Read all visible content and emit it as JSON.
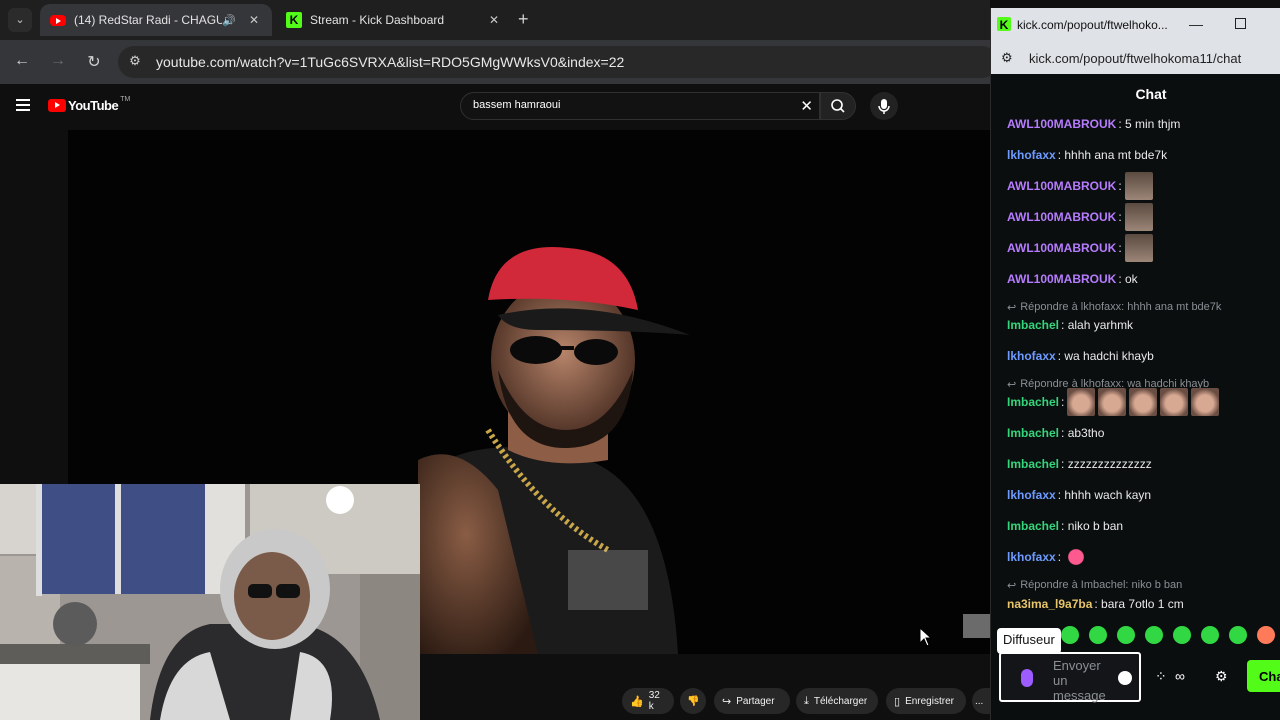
{
  "browser": {
    "tabs": [
      {
        "title": "(14) RedStar Radi - CHAGU",
        "favicon": "youtube-icon",
        "active": true
      },
      {
        "title": "Stream - Kick Dashboard",
        "favicon": "kick-icon",
        "active": false
      }
    ],
    "new_tab_label": "+",
    "url": "youtube.com/watch?v=1TuGc6SVRXA&list=RDO5GMgWWksV0&index=22"
  },
  "youtube": {
    "logo": "YouTube",
    "logo_tm": "TM",
    "search_query": "bassem hamraoui",
    "actions": {
      "likes": "32 k",
      "share": "Partager",
      "download": "Télécharger",
      "save": "Enregistrer",
      "more": "..."
    }
  },
  "kick": {
    "window_title": "kick.com/popout/ftwelhoko...",
    "url": "kick.com/popout/ftwelhokoma11/chat",
    "header": "Chat",
    "messages": [
      {
        "kind": "msg",
        "user": "AWL100MABROUK",
        "text": ": 5 min thjm",
        "color": "#b67cff"
      },
      {
        "kind": "msg",
        "user": "lkhofaxx",
        "text": ": hhhh ana mt bde7k",
        "color": "#6e9bff"
      },
      {
        "kind": "msg",
        "user": "AWL100MABROUK",
        "text": ":",
        "color": "#b67cff",
        "emotes": 1
      },
      {
        "kind": "msg",
        "user": "AWL100MABROUK",
        "text": ":",
        "color": "#b67cff",
        "emotes": 1
      },
      {
        "kind": "msg",
        "user": "AWL100MABROUK",
        "text": ":",
        "color": "#b67cff",
        "emotes": 1
      },
      {
        "kind": "msg",
        "user": "AWL100MABROUK",
        "text": ": ok",
        "color": "#b67cff"
      },
      {
        "kind": "reply",
        "text": "Répondre à lkhofaxx: hhhh ana mt bde7k"
      },
      {
        "kind": "msg",
        "user": "Imbachel",
        "text": ": alah yarhmk",
        "color": "#34d57b"
      },
      {
        "kind": "msg",
        "user": "lkhofaxx",
        "text": ": wa hadchi khayb",
        "color": "#6e9bff"
      },
      {
        "kind": "reply",
        "text": "Répondre à lkhofaxx: wa hadchi khayb"
      },
      {
        "kind": "msg",
        "user": "Imbachel",
        "text": ":",
        "color": "#34d57b",
        "emotes": 5
      },
      {
        "kind": "msg",
        "user": "Imbachel",
        "text": ": ab3tho",
        "color": "#34d57b"
      },
      {
        "kind": "msg",
        "user": "Imbachel",
        "text": ": zzzzzzzzzzzzzz",
        "color": "#34d57b"
      },
      {
        "kind": "msg",
        "user": "lkhofaxx",
        "text": ": hhhh wach kayn",
        "color": "#6e9bff"
      },
      {
        "kind": "msg",
        "user": "Imbachel",
        "text": ": niko b ban",
        "color": "#34d57b"
      },
      {
        "kind": "msg",
        "user": "lkhofaxx",
        "text": ":",
        "color": "#6e9bff",
        "emotes": 1
      },
      {
        "kind": "reply",
        "text": "Répondre à Imbachel: niko b ban"
      },
      {
        "kind": "msg",
        "user": "na3ima_l9a7ba",
        "text": ": bara 7otlo 1 cm",
        "color": "#e8c46a"
      }
    ],
    "tooltip": "Diffuseur",
    "input_placeholder": "Envoyer un message",
    "infinity": "∞",
    "send_label": "Chat"
  }
}
